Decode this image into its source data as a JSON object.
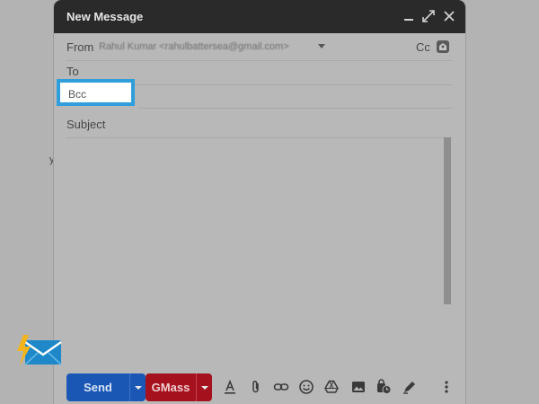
{
  "compose": {
    "title": "New Message",
    "from_label": "From",
    "from_value": "Rahul Kumar <rahulbattersea@gmail.com>",
    "cc_label": "Cc",
    "to_label": "To",
    "bcc_label": "Bcc",
    "subject_label": "Subject"
  },
  "toolbar": {
    "send_label": "Send",
    "gmass_label": "GMass"
  },
  "page": {
    "stray_text": "y"
  },
  "icons": {
    "minimize": "minimize-icon",
    "expand": "expand-icon",
    "close": "close-icon",
    "cc_bcc": "contacts-icon",
    "format": "format-text-icon",
    "attach": "paperclip-icon",
    "link": "link-icon",
    "emoji": "emoji-icon",
    "drive": "drive-icon",
    "photo": "image-icon",
    "schedule": "confidential-mode-icon",
    "signature": "signature-pen-icon",
    "more": "more-vertical-icon",
    "logo": "lightning-envelope-icon"
  },
  "colors": {
    "highlight": "#2f9edb",
    "send": "#1a57b5",
    "gmass": "#a5121e",
    "titlebar": "#2a2a2a"
  }
}
